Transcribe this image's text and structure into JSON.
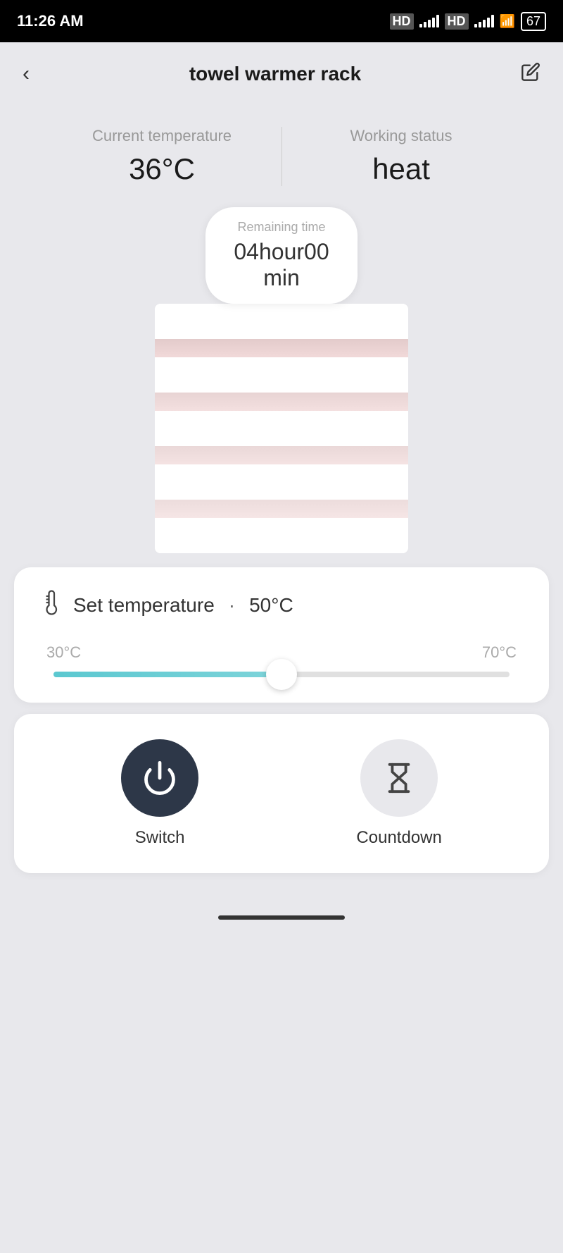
{
  "statusBar": {
    "time": "11:26 AM",
    "battery": "67"
  },
  "header": {
    "title": "towel warmer rack",
    "backLabel": "<",
    "editLabel": "✏"
  },
  "stats": {
    "currentTempLabel": "Current temperature",
    "currentTempValue": "36°C",
    "workingStatusLabel": "Working status",
    "workingStatusValue": "heat"
  },
  "remainingTime": {
    "label": "Remaining time",
    "value": "04hour00",
    "unit": "min"
  },
  "temperatureCard": {
    "iconLabel": "🌡",
    "label": "Set temperature",
    "dot": "·",
    "value": "50°C",
    "sliderMin": "30°C",
    "sliderMax": "70°C",
    "sliderPercent": 50
  },
  "controls": {
    "switchLabel": "Switch",
    "countdownLabel": "Countdown"
  }
}
